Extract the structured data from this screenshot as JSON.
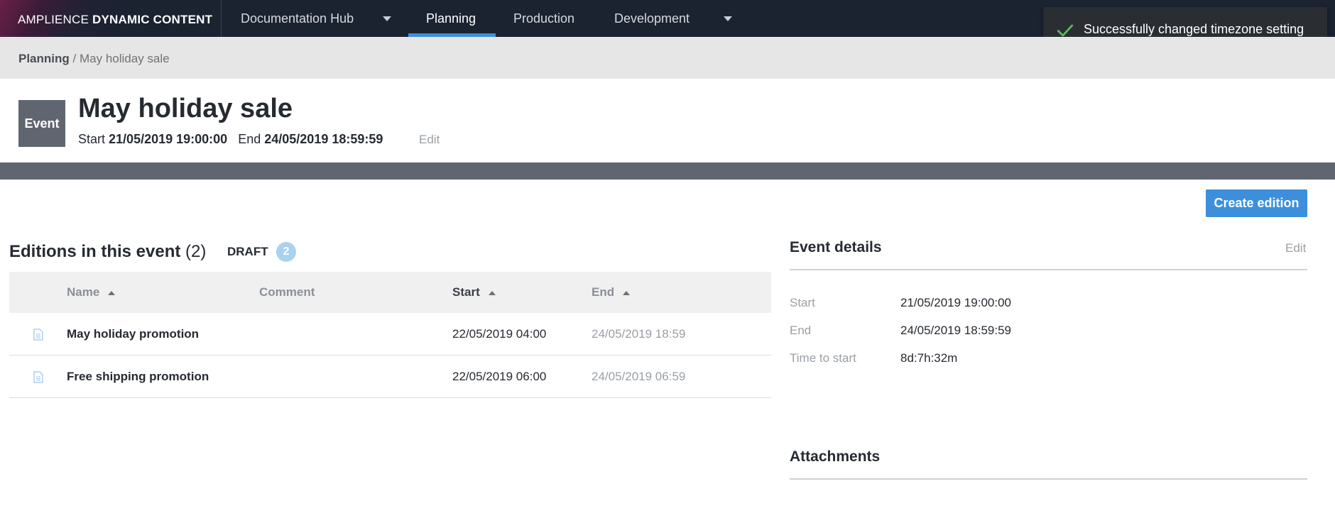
{
  "brand": {
    "light": "AMPLIENCE",
    "bold": "DYNAMIC CONTENT"
  },
  "nav": {
    "hub": "Documentation Hub",
    "tabs": [
      {
        "label": "Planning",
        "active": true
      },
      {
        "label": "Production"
      },
      {
        "label": "Development"
      }
    ]
  },
  "toast": {
    "message": "Successfully changed timezone setting",
    "icon": "check-icon",
    "color": "#5cb85c"
  },
  "breadcrumb": {
    "root": "Planning",
    "separator": "/",
    "current": "May holiday sale"
  },
  "event": {
    "badge": "Event",
    "title": "May holiday sale",
    "start_label": "Start",
    "start_value": "21/05/2019 19:00:00",
    "end_label": "End",
    "end_value": "24/05/2019 18:59:59",
    "edit_label": "Edit"
  },
  "actions": {
    "create_edition": "Create edition"
  },
  "editions": {
    "title": "Editions in this event",
    "count": "(2)",
    "draft_label": "DRAFT",
    "draft_count": "2",
    "columns": {
      "name": "Name",
      "comment": "Comment",
      "start": "Start",
      "end": "End"
    },
    "rows": [
      {
        "name": "May holiday promotion",
        "comment": "",
        "start": "22/05/2019 04:00",
        "end": "24/05/2019 18:59"
      },
      {
        "name": "Free shipping promotion",
        "comment": "",
        "start": "22/05/2019 06:00",
        "end": "24/05/2019 06:59"
      }
    ]
  },
  "details": {
    "title": "Event details",
    "edit_label": "Edit",
    "fields": [
      {
        "label": "Start",
        "value": "21/05/2019 19:00:00"
      },
      {
        "label": "End",
        "value": "24/05/2019 18:59:59"
      },
      {
        "label": "Time to start",
        "value": "8d:7h:32m"
      }
    ]
  },
  "attachments": {
    "title": "Attachments"
  },
  "colors": {
    "accent": "#3d8fdb",
    "topbar": "#1b2230",
    "event_badge": "#5f6670"
  }
}
